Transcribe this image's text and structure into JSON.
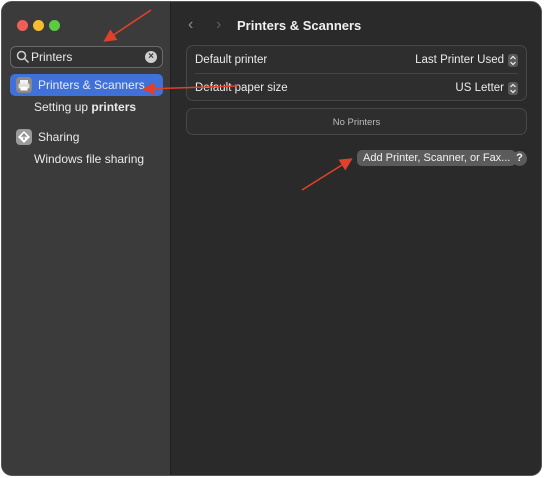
{
  "window": {
    "traffic_lights": [
      "close",
      "minimize",
      "zoom"
    ]
  },
  "sidebar": {
    "search": {
      "value": "Printers",
      "clear_icon": "×"
    },
    "items": [
      {
        "label_part": "Printers",
        "label_rest": " & Scanners",
        "icon": "printer-icon",
        "selected": true
      },
      {
        "label_part": "Setting up ",
        "label_rest": "printers"
      },
      {
        "label": "Sharing",
        "icon": "sharing-icon"
      },
      {
        "label": "Windows file sharing"
      }
    ]
  },
  "header": {
    "back": "‹",
    "forward": "›",
    "title": "Printers & Scanners"
  },
  "settings": {
    "rows": [
      {
        "label": "Default printer",
        "value": "Last Printer Used"
      },
      {
        "label": "Default paper size",
        "value": "US Letter"
      }
    ],
    "empty_list_text": "No Printers",
    "add_button_label": "Add Printer, Scanner, or Fax...",
    "help_label": "?"
  },
  "colors": {
    "sidebar_bg": "#3b3b3b",
    "main_bg": "#2a2a2a",
    "accent_selected": "#3f71d8",
    "annotation_arrow": "#e0412a"
  }
}
